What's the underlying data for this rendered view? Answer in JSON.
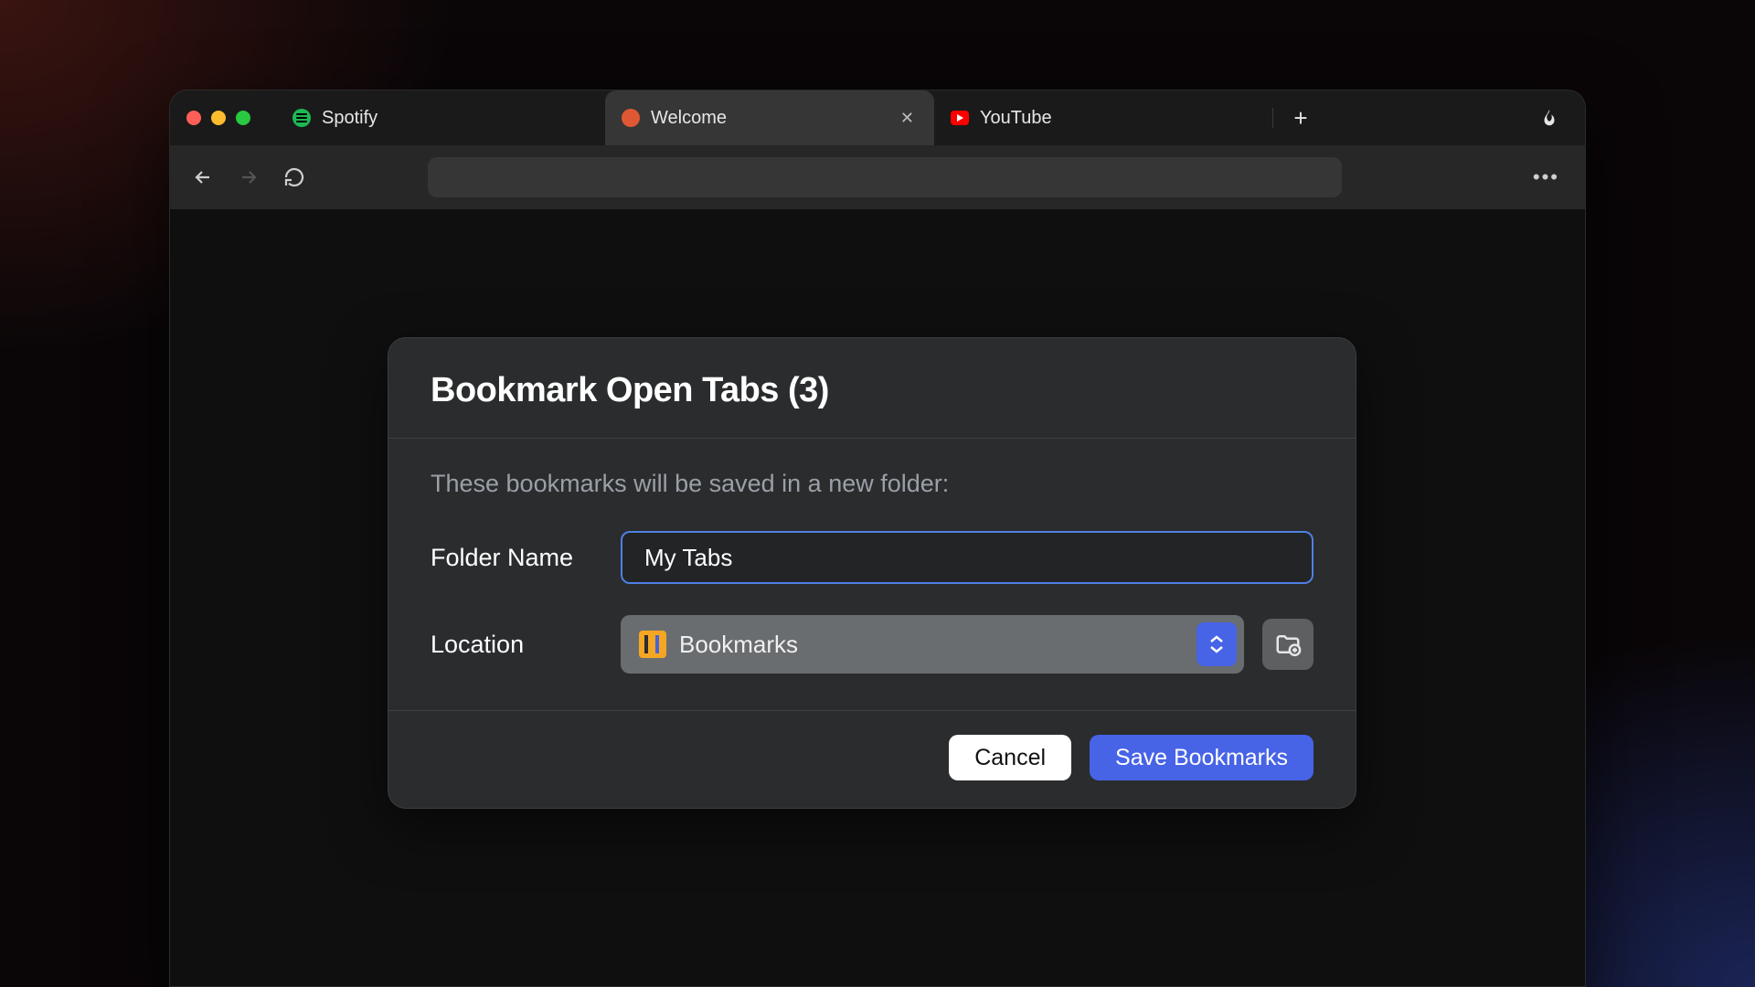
{
  "tabs": [
    {
      "label": "Spotify"
    },
    {
      "label": "Welcome"
    },
    {
      "label": "YouTube"
    }
  ],
  "dialog": {
    "title": "Bookmark Open Tabs (3)",
    "description": "These bookmarks will be saved in a new folder:",
    "folder_name_label": "Folder Name",
    "folder_name_value": "My Tabs",
    "location_label": "Location",
    "location_value": "Bookmarks",
    "cancel_label": "Cancel",
    "save_label": "Save Bookmarks"
  }
}
